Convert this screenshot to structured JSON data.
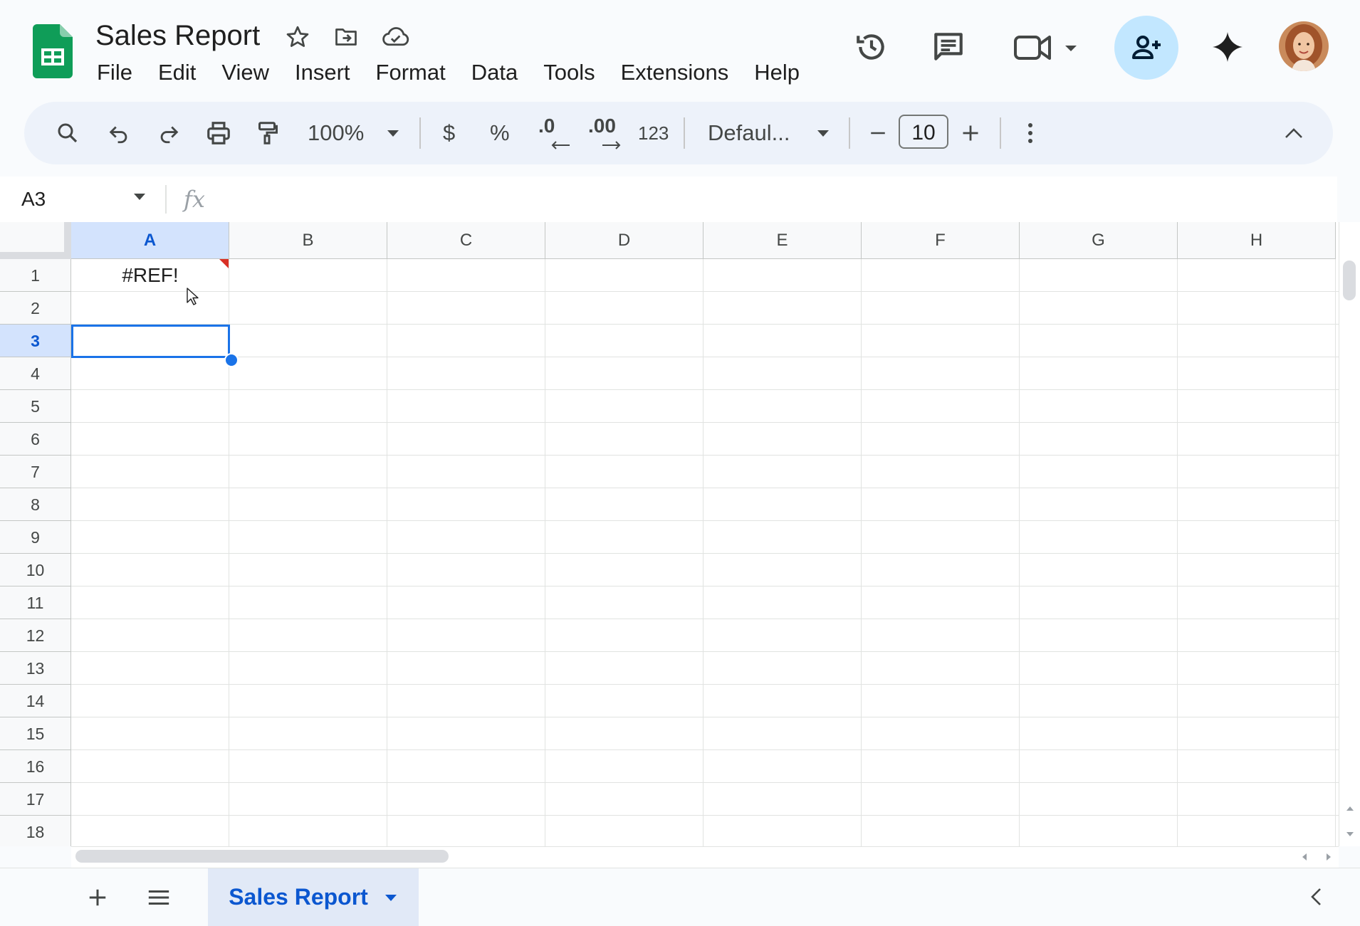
{
  "document": {
    "title": "Sales Report"
  },
  "menu": [
    "File",
    "Edit",
    "View",
    "Insert",
    "Format",
    "Data",
    "Tools",
    "Extensions",
    "Help"
  ],
  "toolbar": {
    "zoom": "100%",
    "currency_label": "$",
    "percent_label": "%",
    "decrease_decimal_label": ".0",
    "increase_decimal_label": ".00",
    "number_format_label": "123",
    "font_family": "Defaul...",
    "font_size": "10"
  },
  "formula_bar": {
    "name_box": "A3",
    "fx_label": "fx",
    "formula": ""
  },
  "grid": {
    "columns": [
      "A",
      "B",
      "C",
      "D",
      "E",
      "F",
      "G",
      "H"
    ],
    "rows": [
      "1",
      "2",
      "3",
      "4",
      "5",
      "6",
      "7",
      "8",
      "9",
      "10",
      "11",
      "12",
      "13",
      "14",
      "15",
      "16",
      "17",
      "18"
    ],
    "selected_column": "A",
    "selected_row": "3",
    "cells": {
      "A1": "#REF!"
    }
  },
  "sheets": {
    "tabs": [
      "Sales Report"
    ],
    "active": "Sales Report"
  },
  "colors": {
    "brand_green": "#0f9d58",
    "accent_blue": "#1a73e8",
    "share_bg": "#c2e7ff",
    "error_red": "#d93025"
  },
  "icons": {
    "header": [
      "sheets-logo-icon",
      "star-icon",
      "move-folder-icon",
      "cloud-saved-icon",
      "version-history-icon",
      "comments-icon",
      "meet-video-icon",
      "share-person-add-icon",
      "gemini-sparkle-icon"
    ],
    "toolbar": [
      "search-icon",
      "undo-icon",
      "redo-icon",
      "print-icon",
      "paint-format-icon",
      "more-vert-icon",
      "collapse-chevron-icon"
    ]
  }
}
